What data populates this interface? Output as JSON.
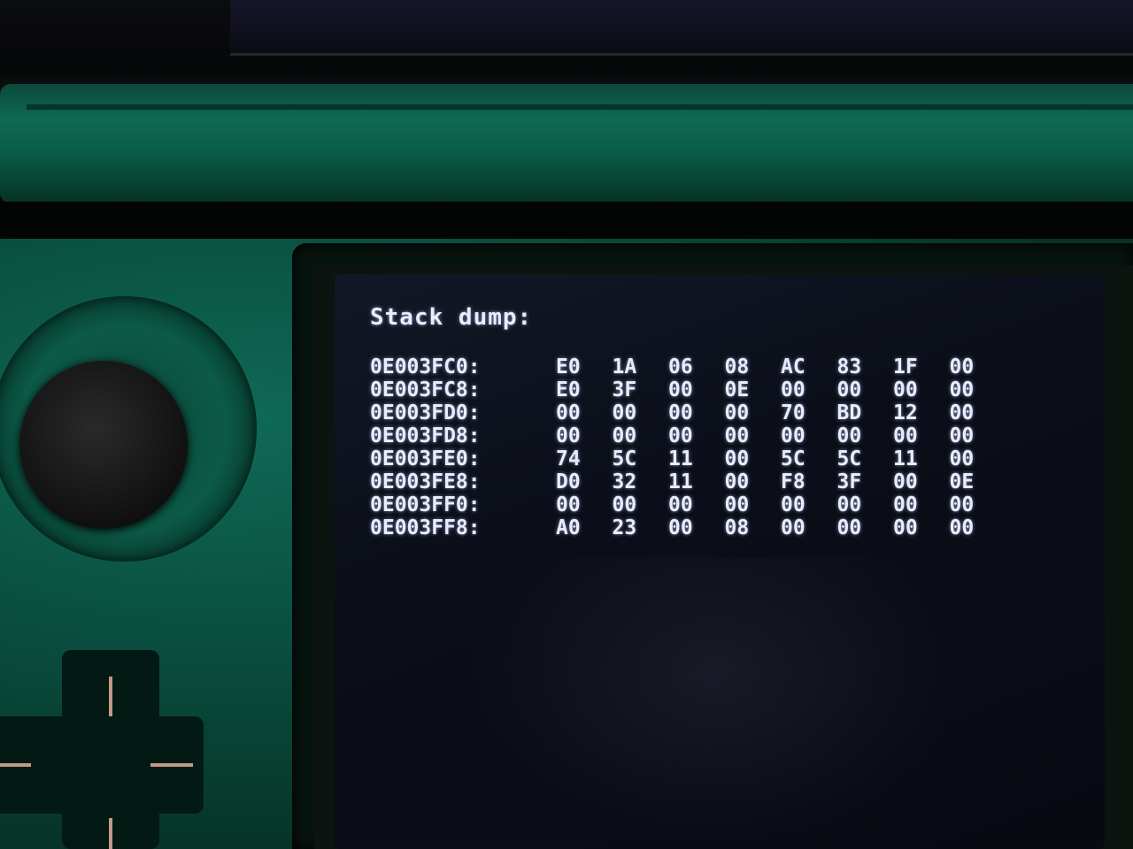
{
  "screen": {
    "title": "Stack dump:",
    "rows": [
      {
        "address": "0E003FC0:",
        "bytes": [
          "E0",
          "1A",
          "06",
          "08",
          "AC",
          "83",
          "1F",
          "00"
        ]
      },
      {
        "address": "0E003FC8:",
        "bytes": [
          "E0",
          "3F",
          "00",
          "0E",
          "00",
          "00",
          "00",
          "00"
        ]
      },
      {
        "address": "0E003FD0:",
        "bytes": [
          "00",
          "00",
          "00",
          "00",
          "70",
          "BD",
          "12",
          "00"
        ]
      },
      {
        "address": "0E003FD8:",
        "bytes": [
          "00",
          "00",
          "00",
          "00",
          "00",
          "00",
          "00",
          "00"
        ]
      },
      {
        "address": "0E003FE0:",
        "bytes": [
          "74",
          "5C",
          "11",
          "00",
          "5C",
          "5C",
          "11",
          "00"
        ]
      },
      {
        "address": "0E003FE8:",
        "bytes": [
          "D0",
          "32",
          "11",
          "00",
          "F8",
          "3F",
          "00",
          "0E"
        ]
      },
      {
        "address": "0E003FF0:",
        "bytes": [
          "00",
          "00",
          "00",
          "00",
          "00",
          "00",
          "00",
          "00"
        ]
      },
      {
        "address": "0E003FF8:",
        "bytes": [
          "A0",
          "23",
          "00",
          "08",
          "00",
          "00",
          "00",
          "00"
        ]
      }
    ]
  },
  "colors": {
    "shell": "#0a5a45",
    "screen_bg": "#0b0e18",
    "text": "#e8ecff"
  },
  "icons": {
    "circle_pad": "circle-pad-icon",
    "dpad": "dpad-icon"
  }
}
